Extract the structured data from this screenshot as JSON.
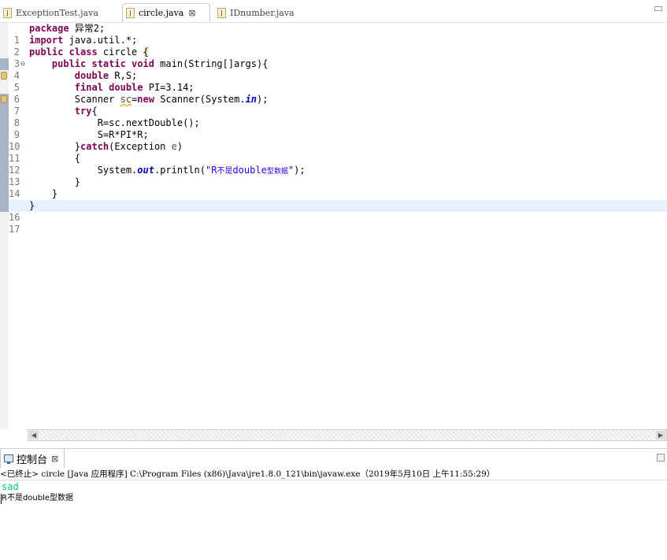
{
  "tabs": [
    {
      "label": "ExceptionTest.java",
      "icon": "java-file-icon",
      "active": false
    },
    {
      "label": "circle.java",
      "icon": "java-file-icon",
      "active": true,
      "close": "⊠"
    },
    {
      "label": "IDnumber.java",
      "icon": "java-file-icon",
      "active": false
    }
  ],
  "editor": {
    "line_numbers": [
      "1",
      "2",
      "3",
      "4",
      "5",
      "6",
      "7",
      "8",
      "9",
      "10",
      "11",
      "12",
      "13",
      "14",
      "15",
      "16",
      "17"
    ],
    "current_line": 16
  },
  "console": {
    "tab_label": "控制台",
    "tab_close": "⊠",
    "info": "<已终止> circle [Java 应用程序] C:\\Program Files (x86)\\Java\\jre1.8.0_121\\bin\\javaw.exe（2019年5月10日 上午11:55:29）",
    "input_line": "sad",
    "output_line": "R不是double型数据"
  },
  "colors": {
    "keyword": "#7f0055",
    "field": "#0000c0",
    "string": "#2a00ff",
    "console_input": "#00c87d",
    "current_line_bg": "#e8f2fe"
  }
}
